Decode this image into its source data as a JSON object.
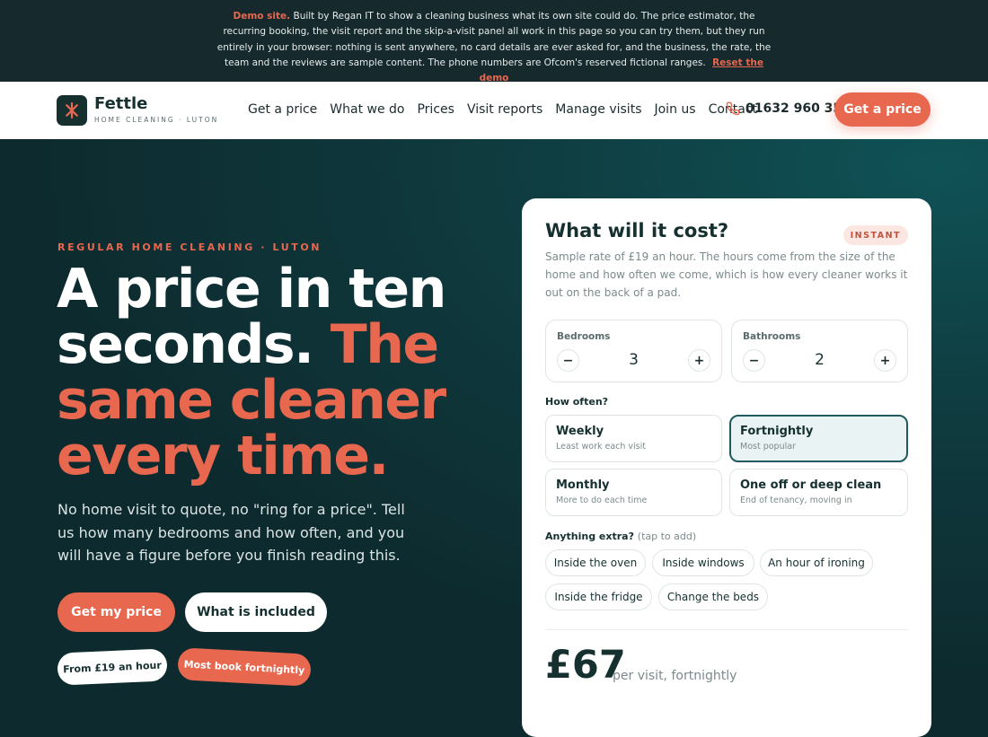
{
  "banner": {
    "demo_label": "Demo site.",
    "text": "Built by Regan IT to show a cleaning business what its own site could do. The price estimator, the recurring booking, the visit report and the skip-a-visit panel all work in this page so you can try them, but they run entirely in your browser: nothing is sent anywhere, no card details are ever asked for, and the business, the rate, the team and the reviews are sample content. The phone numbers are Ofcom's reserved fictional ranges.",
    "reset_label": "Reset the demo"
  },
  "brand": {
    "name": "Fettle",
    "tagline": "HOME CLEANING · LUTON"
  },
  "nav": [
    "Get a price",
    "What we do",
    "Prices",
    "Visit reports",
    "Manage visits",
    "Join us",
    "Contact"
  ],
  "header": {
    "phone": "01632 960 355",
    "cta_label": "Get a price"
  },
  "hero": {
    "eyebrow": "REGULAR HOME CLEANING · LUTON",
    "headline_white": "A price in ten seconds.",
    "headline_accent": "The same cleaner every time.",
    "lede": "No home visit to quote, no \"ring for a price\". Tell us how many bedrooms and how often, and you will have a figure before you finish reading this.",
    "primary_cta": "Get my price",
    "secondary_cta": "What is included",
    "tag_rate": "From £19 an hour",
    "tag_popular": "Most book fortnightly"
  },
  "estimator": {
    "title": "What will it cost?",
    "badge": "INSTANT",
    "description": "Sample rate of £19 an hour. The hours come from the size of the home and how often we come, which is how every cleaner works it out on the back of a pad.",
    "bedrooms": {
      "label": "Bedrooms",
      "value": "3"
    },
    "bathrooms": {
      "label": "Bathrooms",
      "value": "2"
    },
    "frequency_label": "How often?",
    "frequencies": [
      {
        "title": "Weekly",
        "sub": "Least work each visit",
        "selected": false
      },
      {
        "title": "Fortnightly",
        "sub": "Most popular",
        "selected": true
      },
      {
        "title": "Monthly",
        "sub": "More to do each time",
        "selected": false
      },
      {
        "title": "One off or deep clean",
        "sub": "End of tenancy, moving in",
        "selected": false
      }
    ],
    "extras_label": "Anything extra?",
    "extras_hint": "(tap to add)",
    "extras": [
      "Inside the oven",
      "Inside windows",
      "An hour of ironing",
      "Inside the fridge",
      "Change the beds"
    ],
    "price": "£67",
    "price_note": "per visit, fortnightly"
  },
  "colors": {
    "accent": "#e8674f",
    "dark": "#0d2a2e",
    "selected": "#1e5a5e"
  },
  "icons": {
    "logo": "sparkle-icon",
    "phone": "phone-icon"
  }
}
